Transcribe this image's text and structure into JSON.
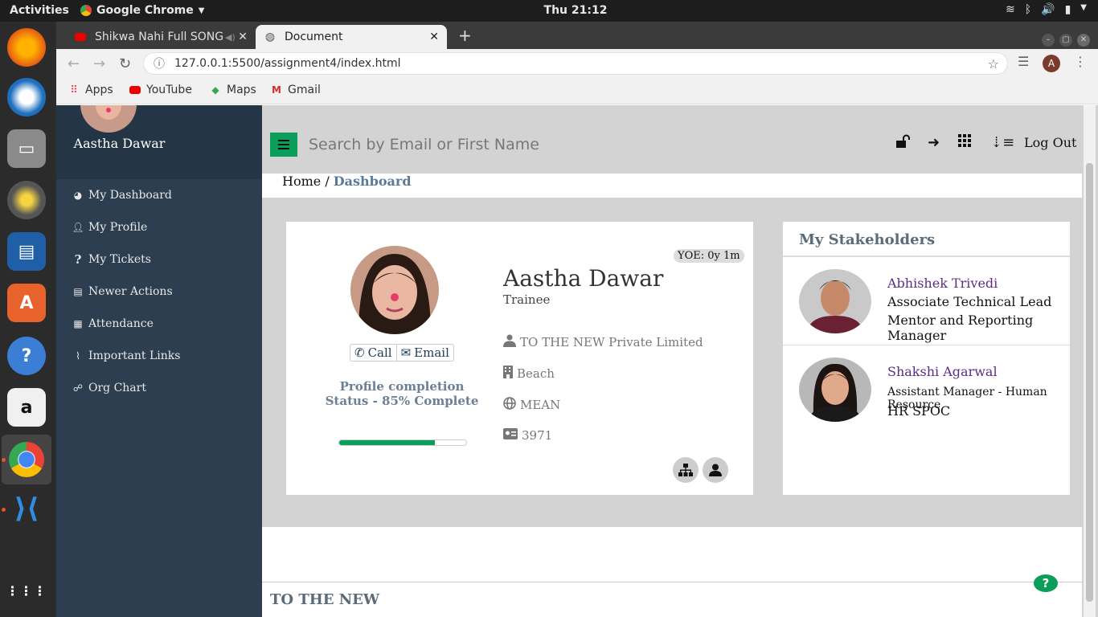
{
  "system": {
    "activities": "Activities",
    "app_menu": "Google Chrome",
    "clock": "Thu 21:12"
  },
  "browser": {
    "tabs": [
      {
        "label": "Shikwa Nahi Full SONG"
      },
      {
        "label": "Document"
      }
    ],
    "url": "127.0.0.1:5500/assignment4/index.html",
    "profile_initial": "A",
    "bookmarks": [
      "Apps",
      "YouTube",
      "Maps",
      "Gmail"
    ]
  },
  "sidebar": {
    "user_name": "Aastha Dawar",
    "items": [
      {
        "label": "My Dashboard",
        "icon": "dashboard-icon"
      },
      {
        "label": "My Profile",
        "icon": "user-icon"
      },
      {
        "label": "My Tickets",
        "icon": "question-icon"
      },
      {
        "label": "Newer Actions",
        "icon": "id-card-icon"
      },
      {
        "label": "Attendance",
        "icon": "clipboard-icon"
      },
      {
        "label": "Important Links",
        "icon": "paperclip-icon"
      },
      {
        "label": "Org Chart",
        "icon": "sitemap-icon"
      }
    ]
  },
  "header": {
    "search_placeholder": "Search by Email or First Name",
    "logout": "Log Out"
  },
  "breadcrumb": {
    "home": "Home",
    "separator": " / ",
    "current": "Dashboard"
  },
  "profile": {
    "yoe": "YOE: 0y 1m",
    "name": "Aastha Dawar",
    "role": "Trainee",
    "call": "Call",
    "email": "Email",
    "completion_line1": "Profile completion",
    "completion_line2": "Status - 85% Complete",
    "completion_fraction": 0.75,
    "company": "TO THE NEW Private Limited",
    "location": "Beach",
    "team": "MEAN",
    "employee_id": "3971"
  },
  "stakeholders": {
    "title": "My Stakeholders",
    "people": [
      {
        "name": "Abhishek Trivedi",
        "line1": "Associate Technical Lead",
        "line2": "Mentor and Reporting Manager"
      },
      {
        "name": "Shakshi Agarwal",
        "line1": "Assistant Manager - Human Resource",
        "line2": "HR SPOC"
      }
    ]
  },
  "footer": {
    "brand": "TO THE NEW",
    "help": "?"
  },
  "colors": {
    "sidebar": "#2c3e50",
    "accent_green": "#0a9e5a",
    "stakeholder_name": "#5b2c83"
  }
}
